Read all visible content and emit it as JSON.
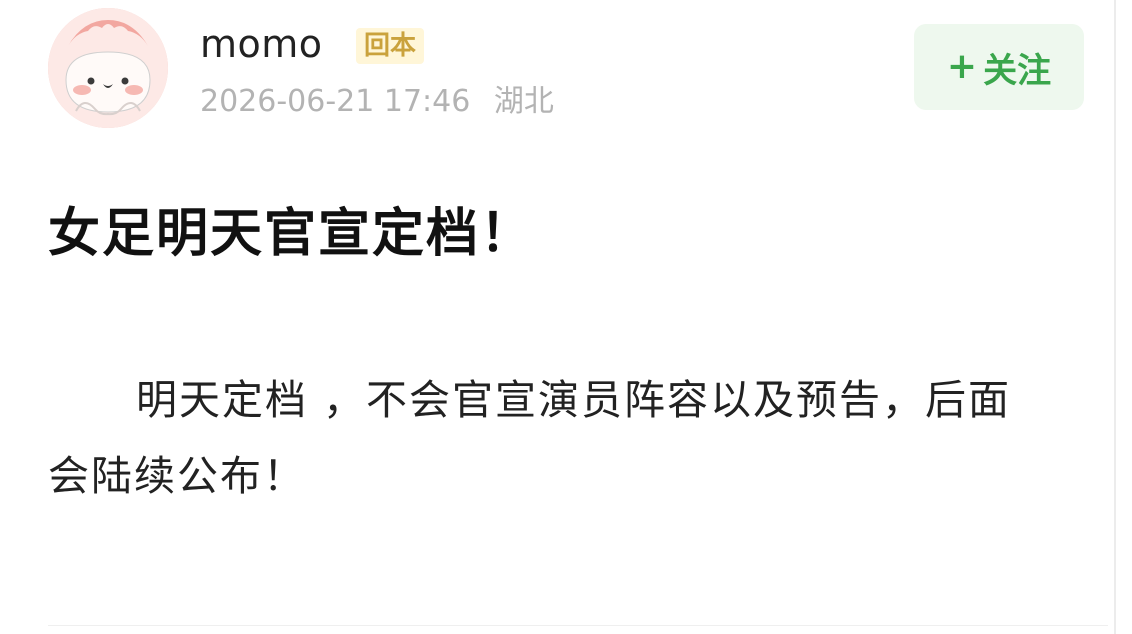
{
  "post": {
    "author": {
      "name": "momo",
      "tag": "回本",
      "avatar_icon": "cartoon-avatar-icon"
    },
    "meta": {
      "datetime": "2026-06-21 17:46",
      "location": "湖北"
    },
    "follow_button": {
      "plus": "+",
      "label": "关注"
    },
    "title": "女足明天官宣定档！",
    "content": "明天定档 ，不会官宣演员阵容以及预告，后面会陆续公布！"
  },
  "colors": {
    "accent_green": "#3aa64c",
    "follow_bg": "#eef8ee",
    "tag_bg": "#fff6d8",
    "tag_text": "#caa23c",
    "meta_text": "#b3b3b3",
    "title_text": "#111111"
  }
}
